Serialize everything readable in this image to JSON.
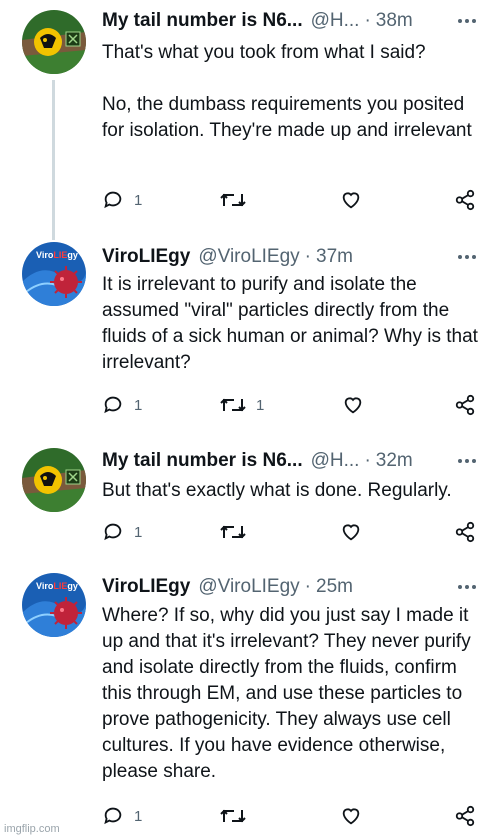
{
  "tweets": [
    {
      "name": "My tail number is N6...",
      "handle": "@H...",
      "time": "38m",
      "text": "That's what you took from what I said?\n\nNo, the dumbass requirements you posited for isolation. They're made up and irrelevant",
      "reply_count": "1",
      "retweet_count": "",
      "avatar": "hawkeye-avatar"
    },
    {
      "name": "ViroLIEgy",
      "handle": "@ViroLIEgy",
      "time": "37m",
      "text": "It is irrelevant to purify and isolate the assumed \"viral\" particles directly from the fluids of a sick human or animal? Why is that irrelevant?",
      "reply_count": "1",
      "retweet_count": "1",
      "avatar": "virus-avatar"
    },
    {
      "name": "My tail number is N6...",
      "handle": "@H...",
      "time": "32m",
      "text": "But that's exactly what is done. Regularly.",
      "reply_count": "1",
      "retweet_count": "",
      "avatar": "hawkeye-avatar"
    },
    {
      "name": "ViroLIEgy",
      "handle": "@ViroLIEgy",
      "time": "25m",
      "text": "Where? If so, why did you just say I made it up and that it's irrelevant? They never purify and isolate directly from the fluids, confirm this through EM, and use these particles to prove pathogenicity. They always use cell cultures. If you have evidence otherwise, please share.",
      "reply_count": "1",
      "retweet_count": "",
      "avatar": "virus-avatar"
    }
  ],
  "separator": "·",
  "more_label": "···",
  "avatar_label": "Viro",
  "avatar_label_highlight": "LIE",
  "avatar_label_end": "gy",
  "watermark": "imgflip.com",
  "colors": {
    "text": "#0f1419",
    "secondary": "#536471",
    "thread_line": "#cfd9de"
  }
}
